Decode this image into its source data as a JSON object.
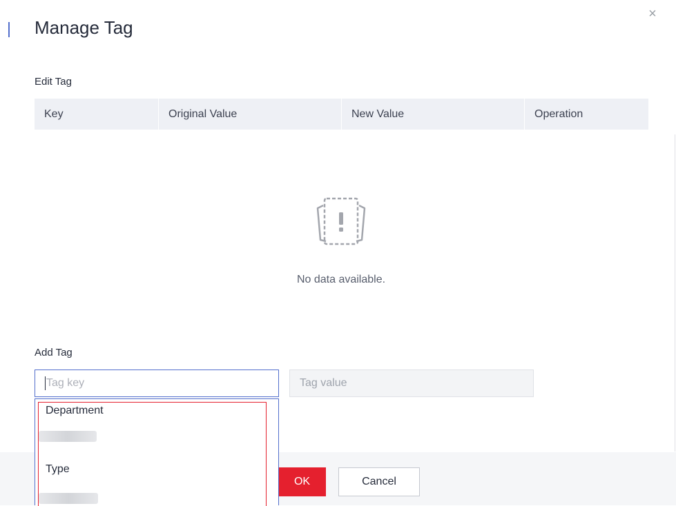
{
  "dialog": {
    "title": "Manage Tag",
    "close_glyph": "×"
  },
  "edit_tag": {
    "label": "Edit Tag",
    "columns": [
      "Key",
      "Original Value",
      "New Value",
      "Operation"
    ],
    "empty_text": "No data available.",
    "empty_icon": "empty-data-icon"
  },
  "add_tag": {
    "label": "Add Tag",
    "key_placeholder": "Tag key",
    "key_value": "",
    "value_placeholder": "Tag value",
    "suggestions": [
      "Department",
      "Type"
    ]
  },
  "footer": {
    "ok_label": "OK",
    "cancel_label": "Cancel"
  },
  "colors": {
    "accent": "#526ecc",
    "ok_red": "#e5202e",
    "highlight_red": "#e5202e"
  }
}
